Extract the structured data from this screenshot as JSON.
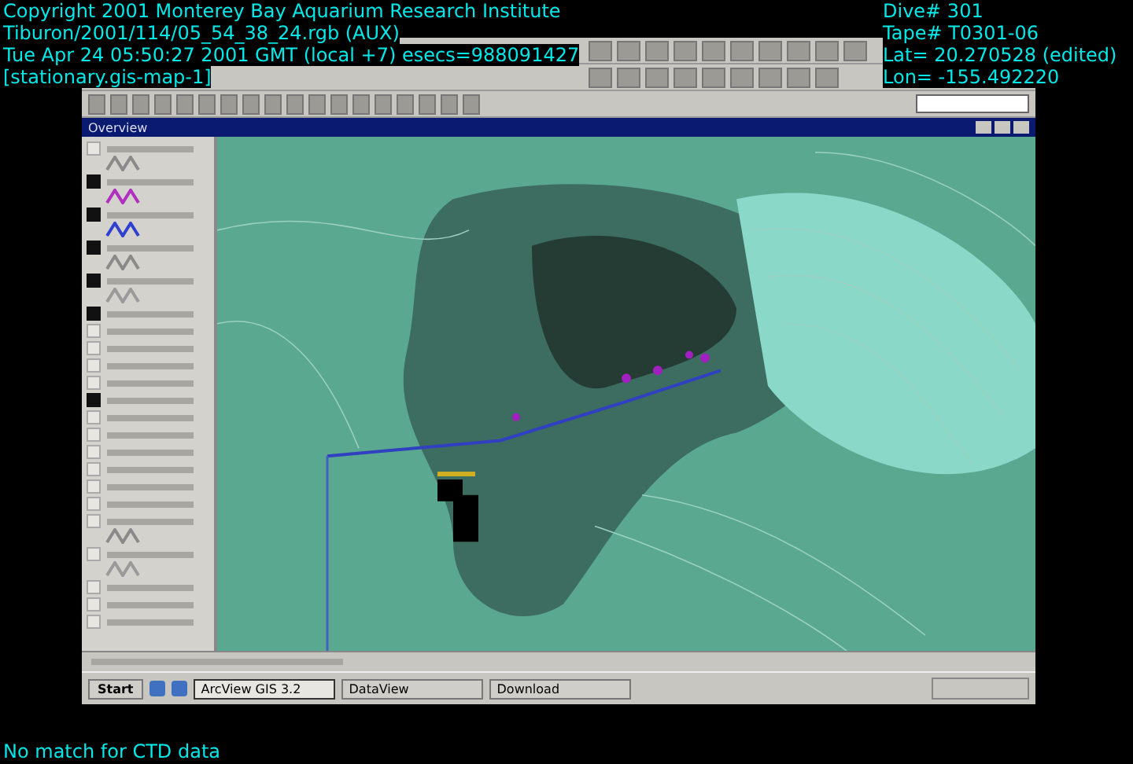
{
  "overlay": {
    "left_lines": [
      "Copyright 2001 Monterey Bay Aquarium Research Institute",
      "Tiburon/2001/114/05_54_38_24.rgb (AUX)",
      "Tue Apr 24 05:50:27 2001 GMT (local +7) esecs=988091427",
      "[stationary.gis-map-1]"
    ],
    "right_lines": [
      "Dive# 301",
      "Tape# T0301-06",
      "Lat= 20.270528 (edited)",
      "Lon= -155.492220"
    ]
  },
  "window": {
    "title": "Overview"
  },
  "layers": [
    {
      "checked": false,
      "kind": "symbol",
      "color": "#8a8a8a"
    },
    {
      "checked": true,
      "kind": "symbol",
      "color": "#b030c0"
    },
    {
      "checked": true,
      "kind": "symbol",
      "color": "#3040d0"
    },
    {
      "checked": true,
      "kind": "symbol",
      "color": "#8a8a8a"
    },
    {
      "checked": true,
      "kind": "symbol",
      "color": "#9a9a9a"
    },
    {
      "checked": true,
      "kind": "plain"
    },
    {
      "checked": false,
      "kind": "plain"
    },
    {
      "checked": false,
      "kind": "plain"
    },
    {
      "checked": false,
      "kind": "plain"
    },
    {
      "checked": false,
      "kind": "plain"
    },
    {
      "checked": true,
      "kind": "plain"
    },
    {
      "checked": false,
      "kind": "plain"
    },
    {
      "checked": false,
      "kind": "plain"
    },
    {
      "checked": false,
      "kind": "plain"
    },
    {
      "checked": false,
      "kind": "plain"
    },
    {
      "checked": false,
      "kind": "plain"
    },
    {
      "checked": false,
      "kind": "plain"
    },
    {
      "checked": false,
      "kind": "symbol",
      "color": "#8a8a8a"
    },
    {
      "checked": false,
      "kind": "symbol",
      "color": "#9a9a9a"
    },
    {
      "checked": false,
      "kind": "plain"
    },
    {
      "checked": false,
      "kind": "plain"
    },
    {
      "checked": false,
      "kind": "plain"
    }
  ],
  "taskbar": {
    "start": "Start",
    "tasks": [
      {
        "label": "ArcView GIS 3.2",
        "selected": true
      },
      {
        "label": "DataView",
        "selected": false
      },
      {
        "label": "Download",
        "selected": false
      }
    ]
  },
  "message": "No match for CTD data"
}
